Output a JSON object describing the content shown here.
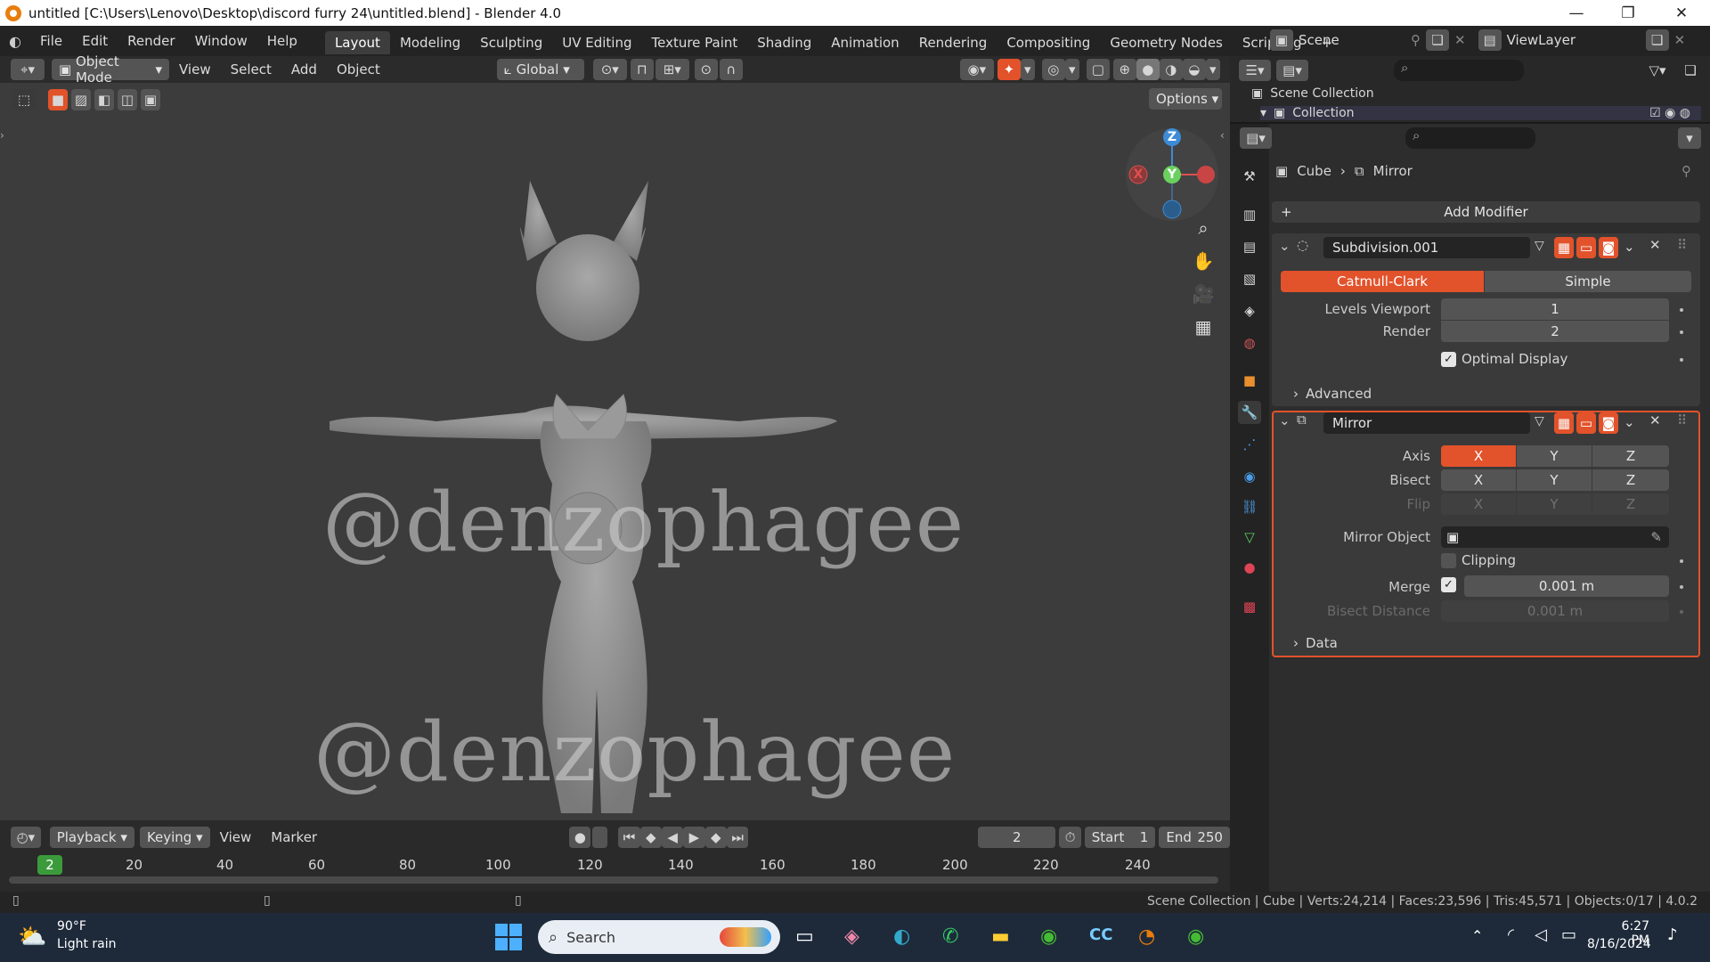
{
  "window": {
    "title": "untitled [C:\\Users\\Lenovo\\Desktop\\discord furry 24\\untitled.blend] - Blender 4.0",
    "min": "—",
    "max": "❐",
    "close": "✕"
  },
  "menu": [
    "File",
    "Edit",
    "Render",
    "Window",
    "Help"
  ],
  "workspaces": [
    "Layout",
    "Modeling",
    "Sculpting",
    "UV Editing",
    "Texture Paint",
    "Shading",
    "Animation",
    "Rendering",
    "Compositing",
    "Geometry Nodes",
    "Scripting"
  ],
  "add_workspace": "+",
  "scene": {
    "name": "Scene",
    "view_layer": "ViewLayer"
  },
  "viewport_header": {
    "mode": "Object Mode",
    "menus": [
      "View",
      "Select",
      "Add",
      "Object"
    ],
    "orientation": "Global",
    "options": "Options"
  },
  "gizmo": {
    "z": "Z",
    "y": "Y",
    "x": "X"
  },
  "watermark": {
    "top": "@denzophagee",
    "bottom": "@denzophagee"
  },
  "outliner": {
    "scene_collection": "Scene Collection",
    "collection": "Collection"
  },
  "properties": {
    "breadcrumb": {
      "object": "Cube",
      "sep": "›",
      "modifier": "Mirror"
    },
    "add_modifier": "Add Modifier",
    "subdivision": {
      "name": "Subdivision.001",
      "type_a": "Catmull-Clark",
      "type_b": "Simple",
      "levels_viewport_label": "Levels Viewport",
      "levels_viewport": "1",
      "render_label": "Render",
      "render": "2",
      "optimal_display": "Optimal Display",
      "advanced": "Advanced"
    },
    "mirror": {
      "name": "Mirror",
      "axis_label": "Axis",
      "bisect_label": "Bisect",
      "flip_label": "Flip",
      "axes": [
        "X",
        "Y",
        "Z"
      ],
      "mirror_object_label": "Mirror Object",
      "clipping": "Clipping",
      "merge_label": "Merge",
      "merge_value": "0.001 m",
      "bisect_distance_label": "Bisect Distance",
      "bisect_distance": "0.001 m",
      "data": "Data"
    }
  },
  "timeline": {
    "menus": [
      "Playback",
      "Keying",
      "View",
      "Marker"
    ],
    "current_frame": "2",
    "start_label": "Start",
    "start": "1",
    "end_label": "End",
    "end": "250",
    "ticks": [
      "20",
      "40",
      "60",
      "80",
      "100",
      "120",
      "140",
      "160",
      "180",
      "200",
      "220",
      "240"
    ],
    "playhead": "2"
  },
  "status": {
    "text": "Scene Collection | Cube | Verts:24,214 | Faces:23,596 | Tris:45,571 | Objects:0/17 | 4.0.2"
  },
  "taskbar": {
    "weather_temp": "90°F",
    "weather_desc": "Light rain",
    "search": "Search",
    "time": "6:27 PM",
    "date": "8/16/2024"
  },
  "colors": {
    "accent": "#e2522b",
    "x_axis": "#e04f4f",
    "y_axis": "#6bd15e",
    "z_axis": "#3d8bd6",
    "frame": "#3b9b3b"
  }
}
